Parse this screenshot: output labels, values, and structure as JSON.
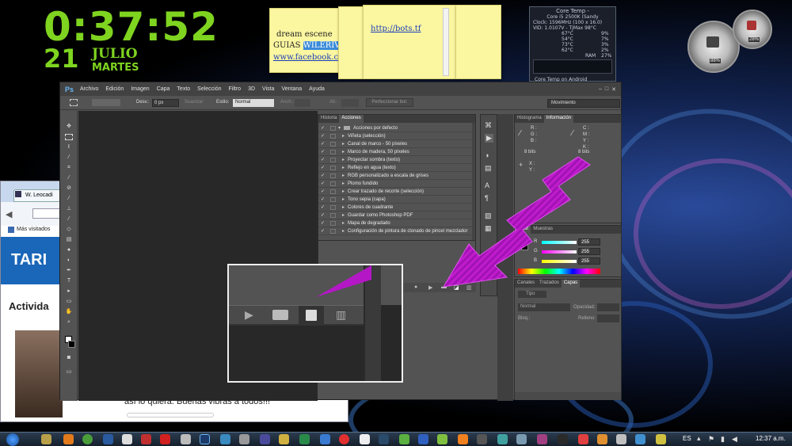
{
  "desktop": {
    "clock": {
      "time": "0:37:52",
      "day": "21",
      "month": "JULIO",
      "weekday": "MARTES"
    },
    "notes": [
      {
        "lines": [
          "dream escene",
          "GUIAS WILERIVA",
          "www.facebook.com/"
        ],
        "highlight": "WILERIVA"
      },
      {
        "lines": [
          "http://bots.tf"
        ]
      }
    ],
    "coretemp": {
      "title": "Core Temp - ",
      "cpu": "Core i5 2500K (Sandy",
      "clock_line": "Clock: 1596MHz (100 x 16.0)",
      "vid_line": "VID: 1.0107V - TjMax 98°C",
      "temps": [
        "67°C",
        "54°C",
        "73°C",
        "62°C"
      ],
      "loads": [
        "9%",
        "7%",
        "3%",
        "2%"
      ],
      "ram_label": "RAM",
      "ram_value": "27%",
      "footer": "Core Temp on Android"
    },
    "gauges": {
      "cpu_percent": "88%",
      "ram_percent": "28%"
    }
  },
  "browser": {
    "tab_title": "W. Leocadi",
    "bookmark": "Más visitados",
    "site_logo": "TARI",
    "heading": "Activida",
    "comment": "así lo quiera. Buenas vibras a todos!!!"
  },
  "photoshop": {
    "logo": "Ps",
    "menu": [
      "Archivo",
      "Edición",
      "Imagen",
      "Capa",
      "Texto",
      "Selección",
      "Filtro",
      "3D",
      "Vista",
      "Ventana",
      "Ayuda"
    ],
    "options": {
      "feather_label": "Desv.:",
      "feather_value": "0 px",
      "antialias": "Suavizar",
      "style_label": "Estilo:",
      "style_value": "Normal",
      "width_label": "Anch.:",
      "height_label": "Alt.:",
      "refine": "Perfeccionar bor.",
      "workspace": "Movimiento"
    },
    "actions_panel": {
      "tabs": [
        "Historia",
        "Acciones"
      ],
      "set_name": "Acciones por defecto",
      "items": [
        "Viñeta (selección)",
        "Canal de marco - 50 píxeles",
        "Marco de madera, 50 píxeles",
        "Proyectar sombra (texto)",
        "Reflejo en agua (texto)",
        "RGB personalizado a escala de grises",
        "Plomo fundido",
        "Crear trazado de recorte (selección)",
        "Tono sepia (capa)",
        "Colores de cuadrante",
        "Guardar como Photoshop PDF",
        "Mapa de degradado",
        "Configuración de pintura de clonado de pincel mezclador"
      ]
    },
    "info_panel": {
      "tabs": [
        "Histograma",
        "Información"
      ],
      "rgb": [
        "R :",
        "G :",
        "B :"
      ],
      "cmyk": [
        "C :",
        "M :",
        "Y :",
        "K :"
      ],
      "bits_left": "8 bits",
      "bits_right": "8 bits",
      "xy": [
        "X :",
        "Y :"
      ]
    },
    "color_panel": {
      "tabs": [
        "Color",
        "Muestras"
      ],
      "channels": [
        {
          "label": "R",
          "value": "255"
        },
        {
          "label": "G",
          "value": "255"
        },
        {
          "label": "B",
          "value": "255"
        }
      ]
    },
    "layers_panel": {
      "tabs": [
        "Canales",
        "Trazados",
        "Capas"
      ],
      "kind": "Tipo",
      "blend": "Normal",
      "opacity_label": "Opacidad:",
      "lock_label": "Bloq.:",
      "fill_label": "Relleno:"
    }
  },
  "taskbar": {
    "lang": "ES",
    "time": "12:37 a.m."
  }
}
